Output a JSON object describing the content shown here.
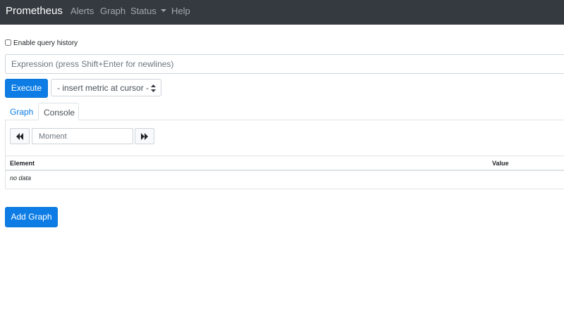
{
  "navbar": {
    "brand": "Prometheus",
    "links": [
      "Alerts",
      "Graph",
      "Status",
      "Help"
    ]
  },
  "query_history": {
    "label": "Enable query history",
    "checked": false
  },
  "expression": {
    "placeholder": "Expression (press Shift+Enter for newlines)"
  },
  "execute_label": "Execute",
  "metric_select": {
    "selected": "- insert metric at cursor -"
  },
  "tabs": [
    {
      "label": "Graph",
      "active": false
    },
    {
      "label": "Console",
      "active": true
    }
  ],
  "console": {
    "moment_placeholder": "Moment",
    "icons": {
      "back": "fast-backward-icon",
      "forward": "fast-forward-icon"
    },
    "table": {
      "headers": [
        "Element",
        "Value"
      ],
      "empty_text": "no data"
    }
  },
  "add_graph_label": "Add Graph",
  "colors": {
    "primary": "#0d7de5",
    "navbar": "#343a40"
  }
}
